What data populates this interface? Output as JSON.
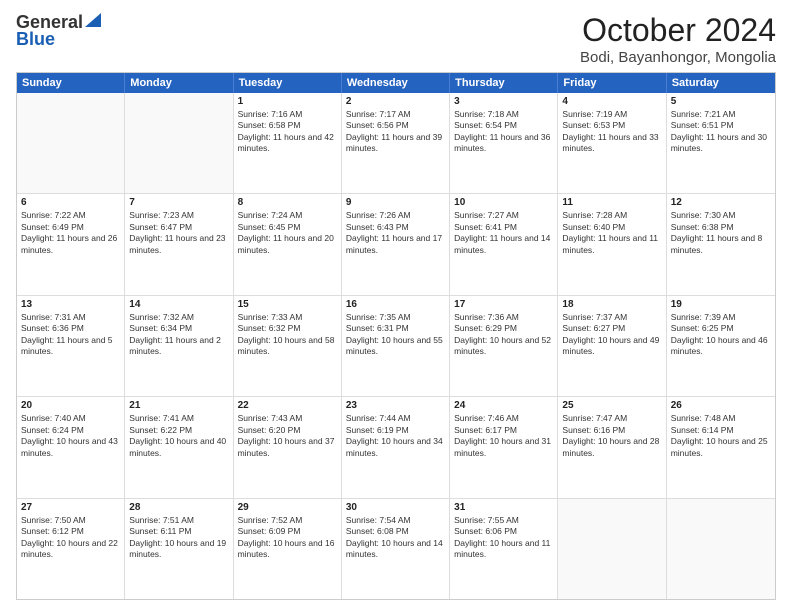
{
  "logo": {
    "general": "General",
    "blue": "Blue"
  },
  "title": "October 2024",
  "subtitle": "Bodi, Bayanhongor, Mongolia",
  "header_days": [
    "Sunday",
    "Monday",
    "Tuesday",
    "Wednesday",
    "Thursday",
    "Friday",
    "Saturday"
  ],
  "rows": [
    [
      {
        "day": "",
        "text": ""
      },
      {
        "day": "",
        "text": ""
      },
      {
        "day": "1",
        "text": "Sunrise: 7:16 AM\nSunset: 6:58 PM\nDaylight: 11 hours and 42 minutes."
      },
      {
        "day": "2",
        "text": "Sunrise: 7:17 AM\nSunset: 6:56 PM\nDaylight: 11 hours and 39 minutes."
      },
      {
        "day": "3",
        "text": "Sunrise: 7:18 AM\nSunset: 6:54 PM\nDaylight: 11 hours and 36 minutes."
      },
      {
        "day": "4",
        "text": "Sunrise: 7:19 AM\nSunset: 6:53 PM\nDaylight: 11 hours and 33 minutes."
      },
      {
        "day": "5",
        "text": "Sunrise: 7:21 AM\nSunset: 6:51 PM\nDaylight: 11 hours and 30 minutes."
      }
    ],
    [
      {
        "day": "6",
        "text": "Sunrise: 7:22 AM\nSunset: 6:49 PM\nDaylight: 11 hours and 26 minutes."
      },
      {
        "day": "7",
        "text": "Sunrise: 7:23 AM\nSunset: 6:47 PM\nDaylight: 11 hours and 23 minutes."
      },
      {
        "day": "8",
        "text": "Sunrise: 7:24 AM\nSunset: 6:45 PM\nDaylight: 11 hours and 20 minutes."
      },
      {
        "day": "9",
        "text": "Sunrise: 7:26 AM\nSunset: 6:43 PM\nDaylight: 11 hours and 17 minutes."
      },
      {
        "day": "10",
        "text": "Sunrise: 7:27 AM\nSunset: 6:41 PM\nDaylight: 11 hours and 14 minutes."
      },
      {
        "day": "11",
        "text": "Sunrise: 7:28 AM\nSunset: 6:40 PM\nDaylight: 11 hours and 11 minutes."
      },
      {
        "day": "12",
        "text": "Sunrise: 7:30 AM\nSunset: 6:38 PM\nDaylight: 11 hours and 8 minutes."
      }
    ],
    [
      {
        "day": "13",
        "text": "Sunrise: 7:31 AM\nSunset: 6:36 PM\nDaylight: 11 hours and 5 minutes."
      },
      {
        "day": "14",
        "text": "Sunrise: 7:32 AM\nSunset: 6:34 PM\nDaylight: 11 hours and 2 minutes."
      },
      {
        "day": "15",
        "text": "Sunrise: 7:33 AM\nSunset: 6:32 PM\nDaylight: 10 hours and 58 minutes."
      },
      {
        "day": "16",
        "text": "Sunrise: 7:35 AM\nSunset: 6:31 PM\nDaylight: 10 hours and 55 minutes."
      },
      {
        "day": "17",
        "text": "Sunrise: 7:36 AM\nSunset: 6:29 PM\nDaylight: 10 hours and 52 minutes."
      },
      {
        "day": "18",
        "text": "Sunrise: 7:37 AM\nSunset: 6:27 PM\nDaylight: 10 hours and 49 minutes."
      },
      {
        "day": "19",
        "text": "Sunrise: 7:39 AM\nSunset: 6:25 PM\nDaylight: 10 hours and 46 minutes."
      }
    ],
    [
      {
        "day": "20",
        "text": "Sunrise: 7:40 AM\nSunset: 6:24 PM\nDaylight: 10 hours and 43 minutes."
      },
      {
        "day": "21",
        "text": "Sunrise: 7:41 AM\nSunset: 6:22 PM\nDaylight: 10 hours and 40 minutes."
      },
      {
        "day": "22",
        "text": "Sunrise: 7:43 AM\nSunset: 6:20 PM\nDaylight: 10 hours and 37 minutes."
      },
      {
        "day": "23",
        "text": "Sunrise: 7:44 AM\nSunset: 6:19 PM\nDaylight: 10 hours and 34 minutes."
      },
      {
        "day": "24",
        "text": "Sunrise: 7:46 AM\nSunset: 6:17 PM\nDaylight: 10 hours and 31 minutes."
      },
      {
        "day": "25",
        "text": "Sunrise: 7:47 AM\nSunset: 6:16 PM\nDaylight: 10 hours and 28 minutes."
      },
      {
        "day": "26",
        "text": "Sunrise: 7:48 AM\nSunset: 6:14 PM\nDaylight: 10 hours and 25 minutes."
      }
    ],
    [
      {
        "day": "27",
        "text": "Sunrise: 7:50 AM\nSunset: 6:12 PM\nDaylight: 10 hours and 22 minutes."
      },
      {
        "day": "28",
        "text": "Sunrise: 7:51 AM\nSunset: 6:11 PM\nDaylight: 10 hours and 19 minutes."
      },
      {
        "day": "29",
        "text": "Sunrise: 7:52 AM\nSunset: 6:09 PM\nDaylight: 10 hours and 16 minutes."
      },
      {
        "day": "30",
        "text": "Sunrise: 7:54 AM\nSunset: 6:08 PM\nDaylight: 10 hours and 14 minutes."
      },
      {
        "day": "31",
        "text": "Sunrise: 7:55 AM\nSunset: 6:06 PM\nDaylight: 10 hours and 11 minutes."
      },
      {
        "day": "",
        "text": ""
      },
      {
        "day": "",
        "text": ""
      }
    ]
  ]
}
